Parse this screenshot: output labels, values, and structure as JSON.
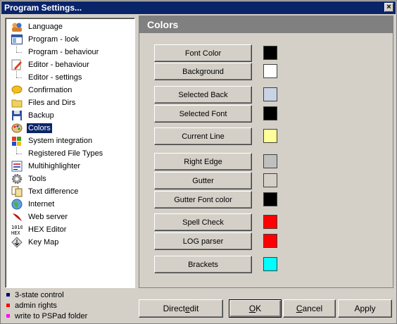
{
  "window": {
    "title": "Program Settings...",
    "close_glyph": "×"
  },
  "tree": {
    "items": [
      {
        "label": "Language",
        "icon": "language-icon",
        "sub": false
      },
      {
        "label": "Program - look",
        "icon": "window-layout-icon",
        "sub": false
      },
      {
        "label": "Program - behaviour",
        "icon": "",
        "sub": true
      },
      {
        "label": "Editor - behaviour",
        "icon": "pencil-icon",
        "sub": false
      },
      {
        "label": "Editor - settings",
        "icon": "",
        "sub": true
      },
      {
        "label": "Confirmation",
        "icon": "speech-bubble-icon",
        "sub": false
      },
      {
        "label": "Files and Dirs",
        "icon": "folder-icon",
        "sub": false
      },
      {
        "label": "Backup",
        "icon": "floppy-disk-icon",
        "sub": false
      },
      {
        "label": "Colors",
        "icon": "palette-icon",
        "sub": false,
        "selected": true
      },
      {
        "label": "System integration",
        "icon": "windows-logo-icon",
        "sub": false
      },
      {
        "label": "Registered File Types",
        "icon": "",
        "sub": true
      },
      {
        "label": "Multihighlighter",
        "icon": "highlighter-list-icon",
        "sub": false
      },
      {
        "label": "Tools",
        "icon": "gear-icon",
        "sub": false
      },
      {
        "label": "Text difference",
        "icon": "compare-icon",
        "sub": false
      },
      {
        "label": "Internet",
        "icon": "globe-icon",
        "sub": false
      },
      {
        "label": "Web server",
        "icon": "feather-icon",
        "sub": false
      },
      {
        "label": "HEX Editor",
        "icon": "hex-icon",
        "sub": false
      },
      {
        "label": "Key Map",
        "icon": "keymap-icon",
        "sub": false
      }
    ]
  },
  "legend": [
    {
      "label": "3-state control",
      "color": "#000080"
    },
    {
      "label": "admin rights",
      "color": "#ff0000"
    },
    {
      "label": "write to PSPad folder",
      "color": "#ff00ff"
    }
  ],
  "panel": {
    "title": "Colors",
    "rows": [
      {
        "label": "Font Color",
        "color": "#000000"
      },
      {
        "label": "Background",
        "color": "#ffffff"
      },
      {
        "label": "Selected Back",
        "color": "#c8d4e4"
      },
      {
        "label": "Selected Font",
        "color": "#000000"
      },
      {
        "label": "Current Line",
        "color": "#ffff99"
      },
      {
        "label": "Right Edge",
        "color": "#c0c0c0"
      },
      {
        "label": "Gutter",
        "color": "#d4d0c8"
      },
      {
        "label": "Gutter Font color",
        "color": "#000000"
      },
      {
        "label": "Spell Check",
        "color": "#ff0000"
      },
      {
        "label": "LOG parser",
        "color": "#ff0000"
      },
      {
        "label": "Brackets",
        "color": "#00ffff"
      }
    ]
  },
  "buttons": {
    "direct_edit": {
      "pre": "Direct ",
      "mn": "e",
      "post": "dit"
    },
    "ok": {
      "pre": "",
      "mn": "O",
      "post": "K"
    },
    "cancel": {
      "pre": "",
      "mn": "C",
      "post": "ancel"
    },
    "apply": {
      "pre": "Apply",
      "mn": "",
      "post": ""
    }
  }
}
